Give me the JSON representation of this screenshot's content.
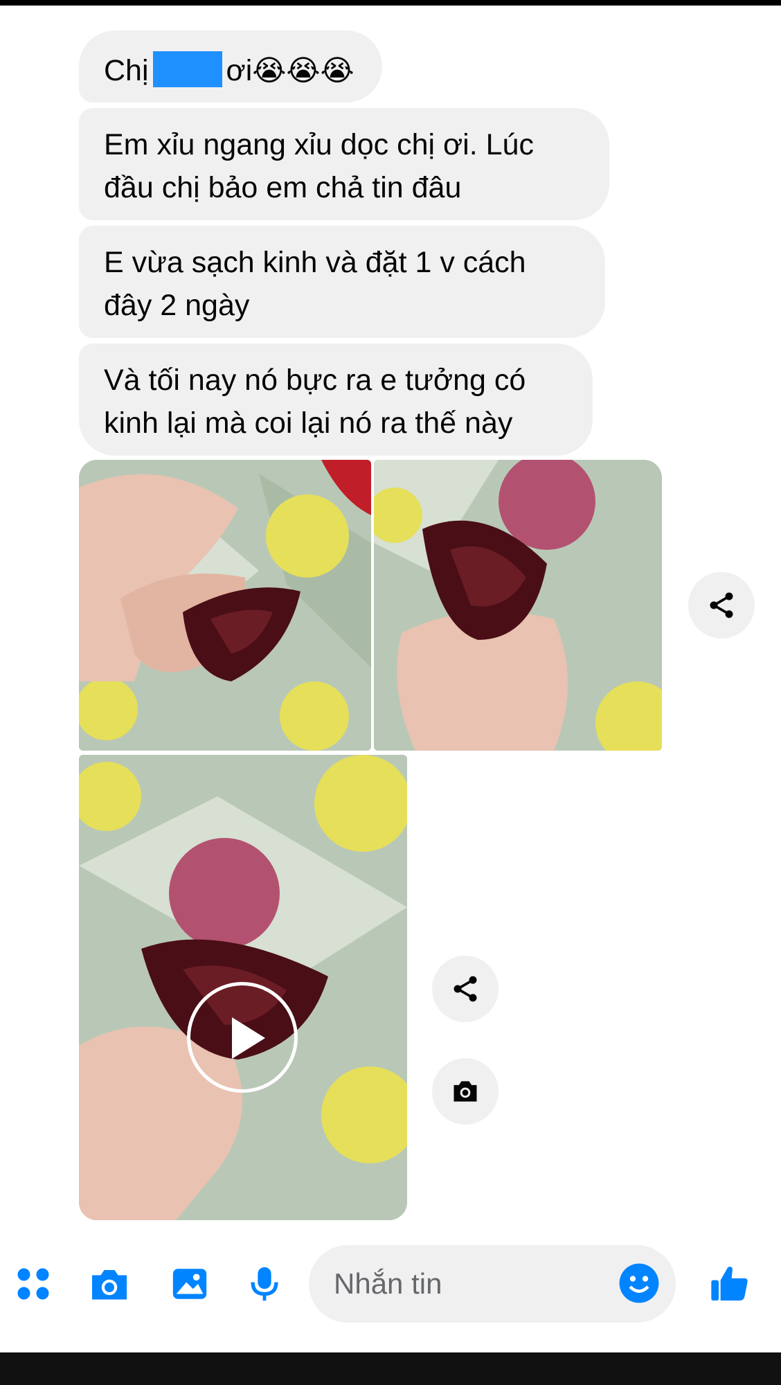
{
  "messages": [
    {
      "pre": "Chị",
      "post": "ơi",
      "emoji": "😭😭😭"
    },
    {
      "text": "Em xỉu ngang xỉu dọc chị ơi. Lúc đầu chị bảo em chả tin đâu",
      "lines": [
        "Em xỉu ngang xỉu dọc chị ơi. Lúc",
        "đầu chị bảo em chả tin đâu"
      ]
    },
    {
      "text": "E vừa sạch  kinh và đặt 1 v cách đây 2 ngày",
      "lines": [
        "E vừa sạch  kinh và đặt 1 v cách",
        "đây 2 ngày"
      ]
    },
    {
      "text": "Và tối nay nó bực ra e tưởng có kinh lại mà coi lại nó ra thế này",
      "lines": [
        "Và tối nay nó bực ra e tưởng có",
        "kinh lại mà coi lại nó ra thế này"
      ]
    }
  ],
  "attachments": [
    {
      "kind": "photo",
      "icon": "photo"
    },
    {
      "kind": "photo",
      "icon": "photo"
    },
    {
      "kind": "video",
      "icon": "play-icon"
    }
  ],
  "composer": {
    "placeholder": "Nhắn tin",
    "icons": [
      "apps-icon",
      "camera-icon",
      "gallery-icon",
      "microphone-icon",
      "emoji-icon",
      "like-icon"
    ]
  },
  "colors": {
    "bubble": "#f0f0f0",
    "accent": "#0084ff",
    "redaction": "#1e90ff",
    "background": "#ffffff"
  }
}
